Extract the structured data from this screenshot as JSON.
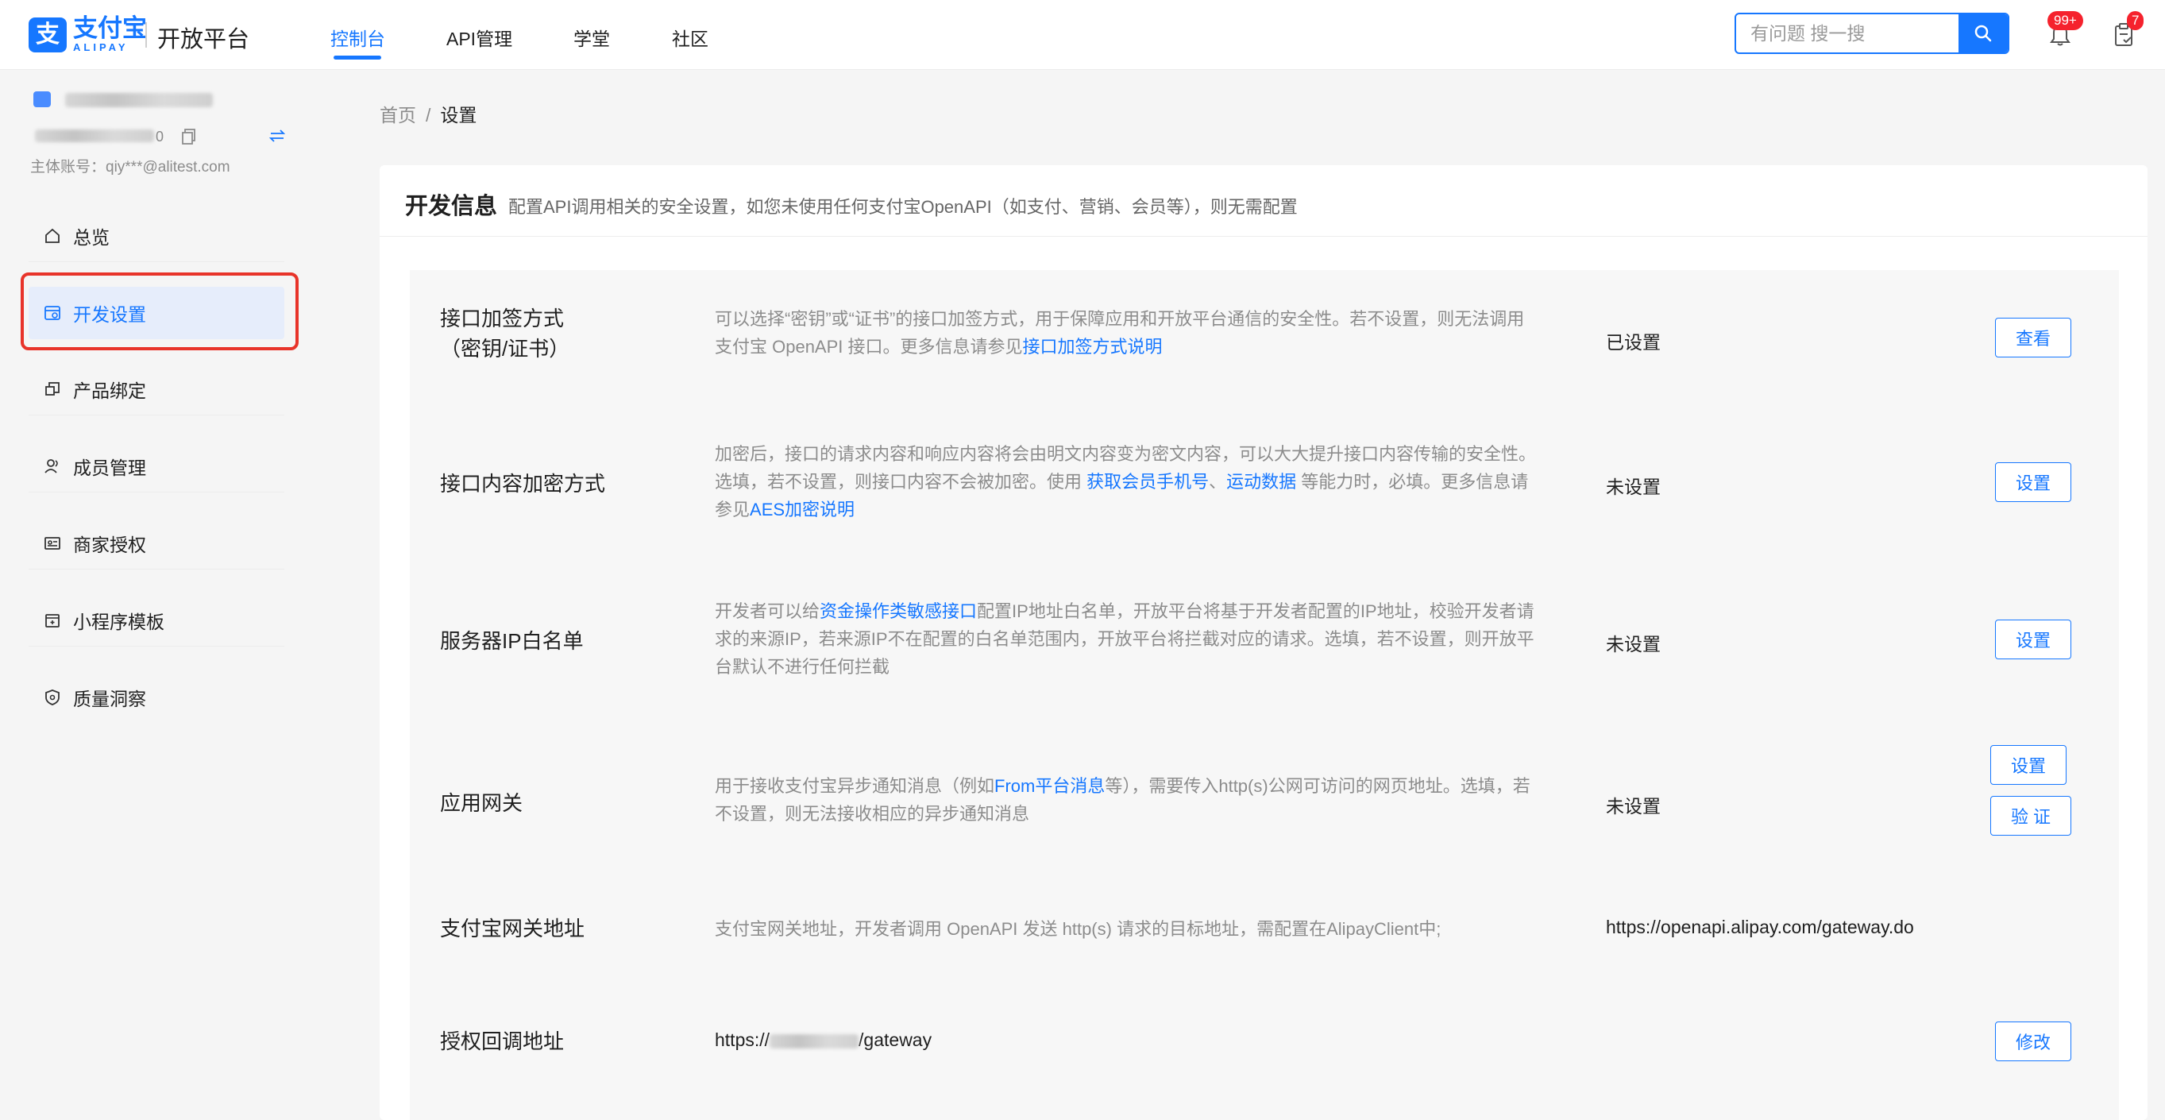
{
  "header": {
    "logo_text": "支付宝",
    "logo_sub": "ALIPAY",
    "logo_mark": "支",
    "platform_name": "开放平台",
    "nav": [
      {
        "label": "控制台",
        "active": true
      },
      {
        "label": "API管理",
        "active": false
      },
      {
        "label": "学堂",
        "active": false
      },
      {
        "label": "社区",
        "active": false
      }
    ],
    "search": {
      "placeholder": "有问题 搜一搜",
      "value": ""
    },
    "notifications_badge": "99+",
    "todo_badge": "7"
  },
  "sidebar": {
    "account_id_suffix": "0",
    "main_account": "主体账号：qiy***@alitest.com",
    "items": [
      {
        "label": "总览",
        "icon": "home-icon",
        "active": false
      },
      {
        "label": "开发设置",
        "icon": "dev-settings-icon",
        "active": true
      },
      {
        "label": "产品绑定",
        "icon": "product-bind-icon",
        "active": false
      },
      {
        "label": "成员管理",
        "icon": "members-icon",
        "active": false
      },
      {
        "label": "商家授权",
        "icon": "merchant-auth-icon",
        "active": false
      },
      {
        "label": "小程序模板",
        "icon": "miniapp-template-icon",
        "active": false
      },
      {
        "label": "质量洞察",
        "icon": "quality-shield-icon",
        "active": false
      }
    ]
  },
  "breadcrumb": {
    "home": "首页",
    "separator": "/",
    "current": "设置"
  },
  "card": {
    "title": "开发信息",
    "desc": "配置API调用相关的安全设置，如您未使用任何支付宝OpenAPI（如支付、营销、会员等），则无需配置"
  },
  "rows": {
    "sign": {
      "title_line1": "接口加签方式",
      "title_line2": "（密钥/证书）",
      "desc_text": "可以选择“密钥”或“证书”的接口加签方式，用于保障应用和开放平台通信的安全性。若不设置，则无法调用支付宝 OpenAPI 接口。更多信息请参见",
      "desc_link": "接口加签方式说明",
      "status": "已设置",
      "button": "查看"
    },
    "encrypt": {
      "title": "接口内容加密方式",
      "desc_a": "加密后，接口的请求内容和响应内容将会由明文内容变为密文内容，可以大大提升接口内容传输的安全性。选填，若不设置，则接口内容不会被加密。使用 ",
      "link_a": "获取会员手机号",
      "sep": "、",
      "link_b": "运动数据",
      "desc_b": " 等能力时，必填。更多信息请参见",
      "link_c": "AES加密说明",
      "status": "未设置",
      "button": "设置"
    },
    "ip": {
      "title": "服务器IP白名单",
      "desc_a": "开发者可以给",
      "link_a": "资金操作类敏感接口",
      "desc_b": "配置IP地址白名单，开放平台将基于开发者配置的IP地址，校验开发者请求的来源IP，若来源IP不在配置的白名单范围内，开放平台将拦截对应的请求。选填，若不设置，则开放平台默认不进行任何拦截",
      "status": "未设置",
      "button": "设置"
    },
    "gateway": {
      "title": "应用网关",
      "desc_a": "用于接收支付宝异步通知消息（例如",
      "link_a": "From平台消息",
      "desc_b": "等），需要传入http(s)公网可访问的网页地址。选填，若不设置，则无法接收相应的异步通知消息",
      "status": "未设置",
      "button_set": "设置",
      "button_verify": "验 证"
    },
    "alipay_gateway": {
      "title": "支付宝网关地址",
      "desc": "支付宝网关地址，开发者调用 OpenAPI 发送 http(s) 请求的目标地址，需配置在AlipayClient中;",
      "value": "https://openapi.alipay.com/gateway.do"
    },
    "callback": {
      "title": "授权回调地址",
      "value_prefix": "https://",
      "value_suffix": "/gateway",
      "button": "修改"
    }
  },
  "colors": {
    "accent": "#1677ff",
    "badge": "#f5222d",
    "highlight": "#e8342a"
  }
}
